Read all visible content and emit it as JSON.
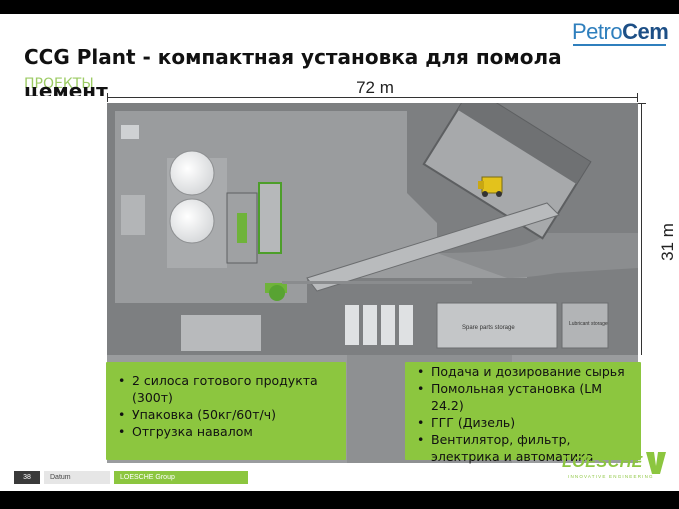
{
  "brand": {
    "logo_part1": "Petro",
    "logo_part2": "Cem",
    "accent": "#8cc63f",
    "logo_blue": "#2f7fbd"
  },
  "slide": {
    "title": "ССG Plant - компактная установка для помола",
    "title_continuation": "цемент",
    "subtitle": "ПРОЕКТЫ"
  },
  "dimensions": {
    "width_label": "72 m",
    "height_label": "31 m"
  },
  "plan_labels": {
    "spare_parts": "Spare parts storage",
    "lubricant": "Lubricant storage"
  },
  "box_left": {
    "items": [
      "2 силоса готового продукта (300т)",
      "Упаковка (50кг/60т/ч)",
      "Отгрузка навалом"
    ]
  },
  "box_right": {
    "items": [
      "Подача и дозирование сырья",
      "Помольная установка (LM 24.2)",
      "ГГГ (Дизель)",
      "Вентилятор, фильтр, электрика и автоматика"
    ]
  },
  "footer": {
    "page_number": "38",
    "datum": "Datum",
    "group": "LOESCHE Group",
    "company_logo": "LOESCHE",
    "company_tagline": "INNOVATIVE ENGINEERING"
  }
}
